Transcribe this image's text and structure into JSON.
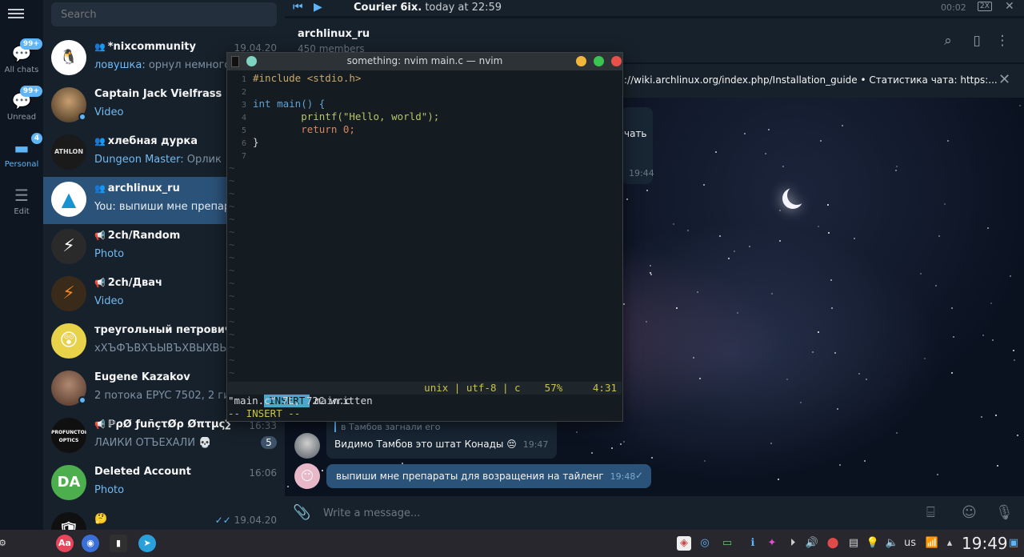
{
  "folders": [
    {
      "label": "All chats",
      "badge": "99+",
      "icon": "chat-bubble-icon"
    },
    {
      "label": "Unread",
      "badge": "99+",
      "icon": "chat-bubble-icon"
    },
    {
      "label": "Personal",
      "badge": "4",
      "icon": "folder-icon"
    },
    {
      "label": "Edit",
      "icon": "list-icon"
    }
  ],
  "search": {
    "placeholder": "Search"
  },
  "chats": [
    {
      "name": "*nixcommunity",
      "group": true,
      "time": "19.04.20",
      "sender": "ловушка:",
      "preview": " орнул немного",
      "avatar_color": "#ffffff"
    },
    {
      "name": "Captain Jack Vielfrass",
      "time": "",
      "preview": "Video",
      "media": true,
      "online": true,
      "avatar_color": "#4a3b2c"
    },
    {
      "name": "хлебная дурка",
      "group": true,
      "time": "",
      "sender": "Dungeon Master:",
      "preview": " Орлик",
      "avatar_color": "#1a1a1a"
    },
    {
      "name": "archlinux_ru",
      "group": true,
      "time": "",
      "sender": "You:",
      "preview": " выпиши мне препараты",
      "active": true,
      "avatar_color": "#ffffff"
    },
    {
      "name": "2ch/Random",
      "channel": true,
      "time": "",
      "preview": "Photo",
      "media": true,
      "avatar_color": "#2a2a2a"
    },
    {
      "name": "2ch/Двач",
      "channel": true,
      "time": "",
      "preview": "Video",
      "media": true,
      "avatar_color": "#3a2a1a"
    },
    {
      "name": "треугольный петрович",
      "time": "",
      "preview": "хХЪФЪВХЪЫВЪХВЫХВЫХЪ",
      "avatar_color": "#e8d24a"
    },
    {
      "name": "Eugene Kazakov",
      "time": "",
      "preview": "2 потока EPYC 7502, 2 гига ОЗУ",
      "online": true,
      "avatar_color": "#6a5040"
    },
    {
      "name": "ℙρØ ƒuñçτØρ Øπτµς∑ |",
      "channel": true,
      "time": "16:33",
      "preview": "ЛАЙКИ ОТЪЕХАЛИ 💀",
      "count": "5",
      "avatar_color": "#101010",
      "avatar_text": "PROFUNCTOR OPTICS"
    },
    {
      "name": "Deleted Account",
      "time": "16:06",
      "preview": "Photo",
      "media": true,
      "avatar_color": "#4cae4c",
      "avatar_text": "DA"
    },
    {
      "name": "🤔",
      "time": "19.04.20",
      "preview": "",
      "avatar_color": "#101010",
      "read": true
    }
  ],
  "player": {
    "prev": "⏮",
    "play": "▶",
    "title": "Courier 6ix.",
    "time_text": " today at 22:59",
    "duration": "00:02",
    "speed": "2X",
    "close": "✕"
  },
  "header": {
    "title": "archlinux_ru",
    "subtitle": "450 members"
  },
  "pinned": {
    "text": "://wiki.archlinux.org/index.php/Installation_guide  • Статистика чата: https:...",
    "close": "✕"
  },
  "messages": {
    "bubble1_text": "чать",
    "bubble1_time": "19:44",
    "reply_quote": "в Тамбов загнали его",
    "msg1_text": "Видимо Тамбов это штат Конады 😔",
    "msg1_time": "19:47",
    "msg2_text": "выпиши мне препараты для возращения на тайленг",
    "msg2_time": "19:48"
  },
  "composer": {
    "placeholder": "Write a message..."
  },
  "terminal": {
    "title": "something: nvim main.c — nvim",
    "lines": [
      {
        "n": "1",
        "text": "#include <stdio.h>"
      },
      {
        "n": "2",
        "text": ""
      },
      {
        "n": "3",
        "text": "int main() {"
      },
      {
        "n": "4",
        "text": "        printf(\"Hello, world\");"
      },
      {
        "n": "5",
        "text": "        return 0;"
      },
      {
        "n": "6",
        "text": "}"
      },
      {
        "n": "7",
        "text": ""
      }
    ],
    "mode": "INSERT",
    "file": "main.c",
    "status_right": "unix | utf-8 | c    57%     4:31",
    "message": "\"main.c\" 7L, 72C written",
    "modeline": "-- INSERT --"
  },
  "taskbar": {
    "keyboard": "us",
    "clock": "19:49"
  },
  "colors": {
    "accent": "#5eb5f7",
    "active_chat": "#2b5278",
    "sidebar": "#17212b"
  }
}
